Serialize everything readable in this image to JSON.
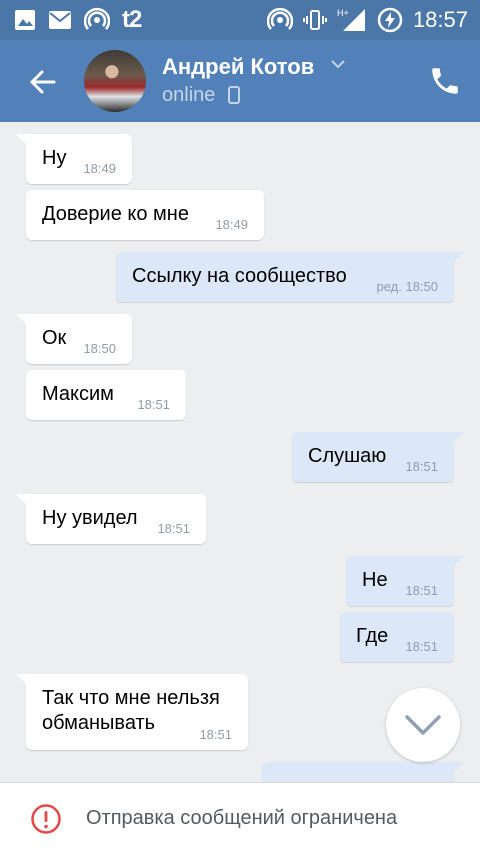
{
  "status_bar": {
    "carrier": "t2",
    "time": "18:57",
    "network": "H+"
  },
  "header": {
    "name": "Андрей Котов",
    "status": "online",
    "colors": {
      "bar": "#5181b8",
      "status_bar": "#4a76a8"
    }
  },
  "messages": [
    {
      "dir": "in",
      "text": "Ну",
      "time": "18:49"
    },
    {
      "dir": "in",
      "text": "Доверие ко мне",
      "time": "18:49"
    },
    {
      "dir": "out",
      "text": "Ссылку на сообщество",
      "time": "ред. 18:50"
    },
    {
      "dir": "in",
      "text": "Ок",
      "time": "18:50"
    },
    {
      "dir": "in",
      "text": "Максим",
      "time": "18:51"
    },
    {
      "dir": "out",
      "text": "Слушаю",
      "time": "18:51"
    },
    {
      "dir": "in",
      "text": "Ну увидел",
      "time": "18:51"
    },
    {
      "dir": "out",
      "text": "Не",
      "time": "18:51"
    },
    {
      "dir": "out",
      "text": "Где",
      "time": "18:51"
    },
    {
      "dir": "in",
      "text": "Так что мне нельзя\nобманывать",
      "time": "18:51"
    }
  ],
  "bottom_bar": {
    "text": "Отправка сообщений ограничена",
    "icon": "alert-circle-icon",
    "accent": "#e64646"
  }
}
